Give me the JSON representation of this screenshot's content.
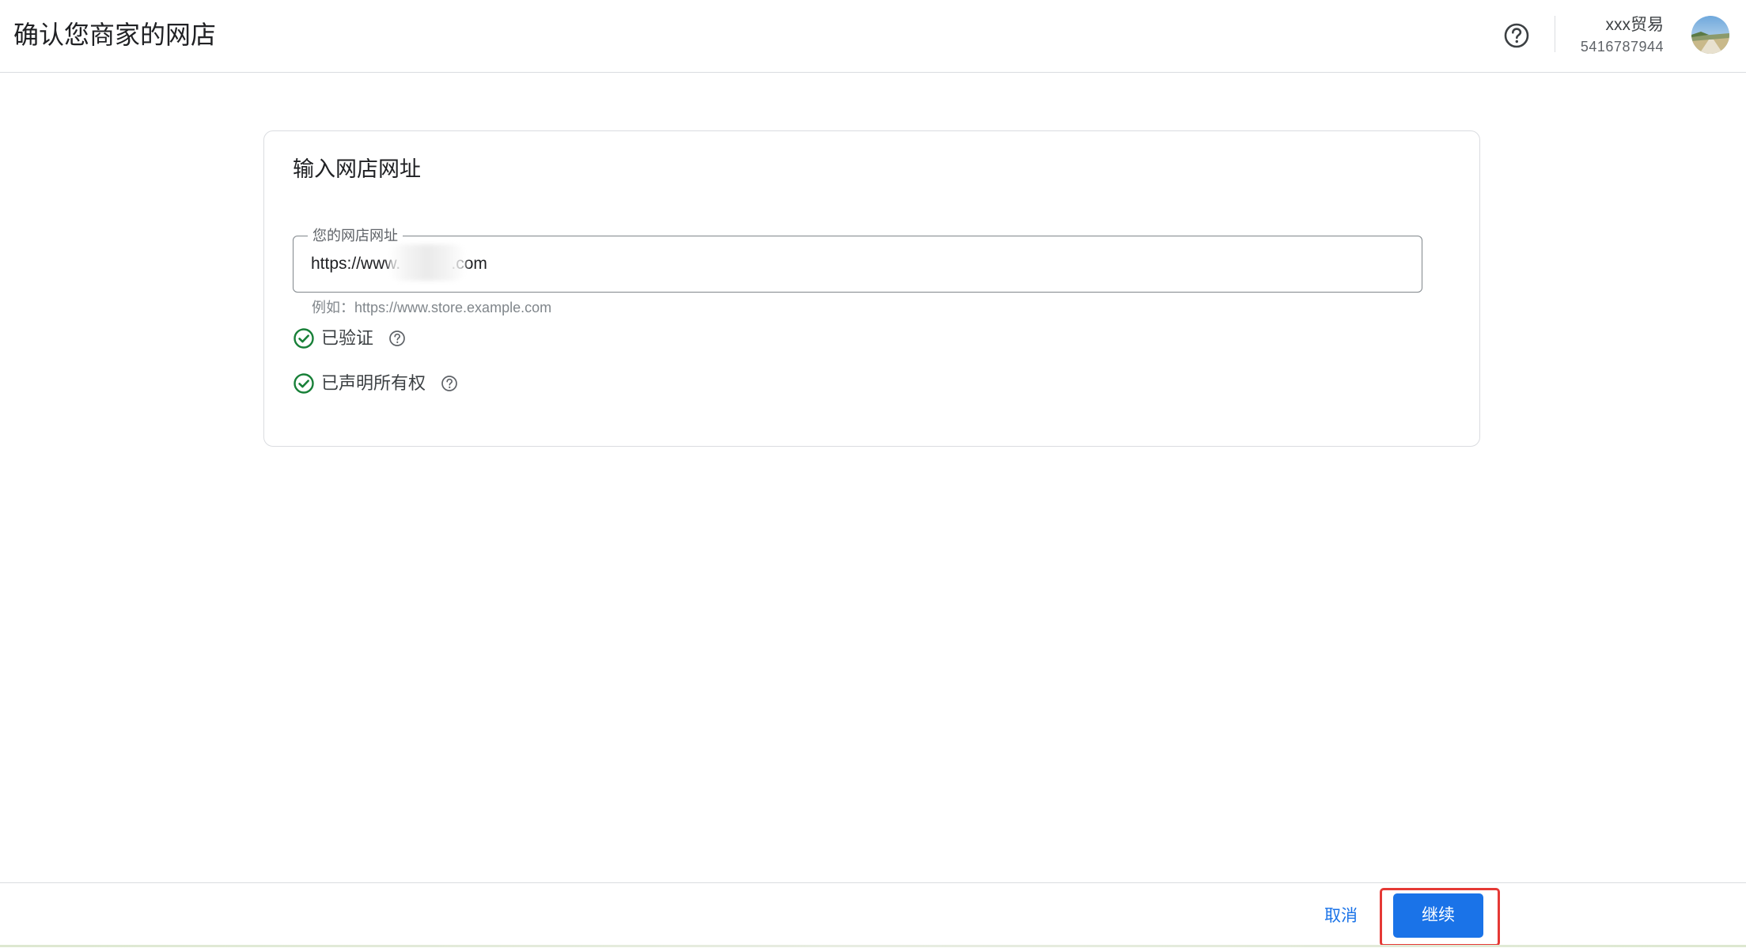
{
  "header": {
    "title": "确认您商家的网店",
    "help_icon": "help-circle-icon",
    "account_name": "xxx贸易",
    "account_id": "5416787944",
    "avatar_icon": "avatar-image"
  },
  "card": {
    "title": "输入网店网址",
    "field_label": "您的网店网址",
    "field_value": "https://www.           .com",
    "hint": "例如：https://www.store.example.com",
    "statuses": [
      {
        "label": "已验证",
        "icon": "check-circle-icon",
        "help_icon": "help-circle-icon"
      },
      {
        "label": "已声明所有权",
        "icon": "check-circle-icon",
        "help_icon": "help-circle-icon"
      }
    ]
  },
  "footer": {
    "cancel_label": "取消",
    "continue_label": "继续"
  },
  "colors": {
    "accent": "#1a73e8",
    "success": "#188038",
    "highlight": "#e53935"
  }
}
